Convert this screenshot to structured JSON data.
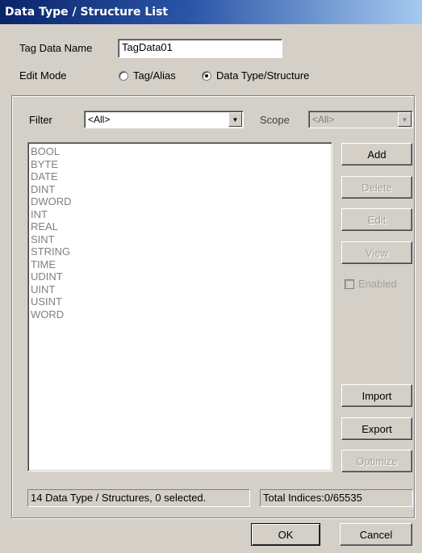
{
  "window": {
    "title": "Data Type / Structure List"
  },
  "tag_data_name": {
    "label": "Tag Data Name",
    "value": "TagData01"
  },
  "edit_mode": {
    "label": "Edit Mode",
    "options": [
      "Tag/Alias",
      "Data Type/Structure"
    ],
    "selected": "Data Type/Structure"
  },
  "filter": {
    "label": "Filter",
    "value": "<All>"
  },
  "scope": {
    "label": "Scope",
    "value": "<All>"
  },
  "list": {
    "items": [
      "BOOL",
      "BYTE",
      "DATE",
      "DINT",
      "DWORD",
      "INT",
      "REAL",
      "SINT",
      "STRING",
      "TIME",
      "UDINT",
      "UINT",
      "USINT",
      "WORD"
    ]
  },
  "buttons": {
    "add": "Add",
    "delete": "Delete",
    "edit": "Edit",
    "view": "View",
    "import": "Import",
    "export": "Export",
    "optimize": "Optimize",
    "ok": "OK",
    "cancel": "Cancel"
  },
  "enabled_checkbox": {
    "label": "Enabled",
    "checked": false
  },
  "status": {
    "summary": "14 Data Type / Structures, 0 selected.",
    "indices": "Total Indices:0/65535"
  }
}
